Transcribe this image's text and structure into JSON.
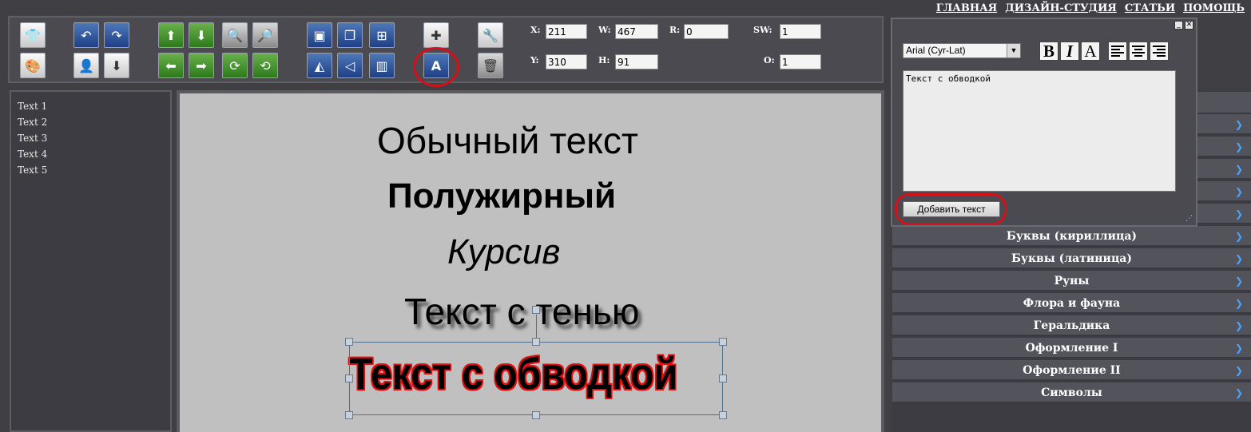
{
  "topnav": {
    "items": [
      "ГЛАВНАЯ",
      "ДИЗАЙН-СТУДИЯ",
      "СТАТЬИ",
      "ПОМОЩЬ"
    ]
  },
  "toolbar": {
    "icons": {
      "shirt": "shirt-icon",
      "palette": "palette-icon",
      "undo": "undo-icon",
      "redo": "redo-icon",
      "user_search": "user-search-icon",
      "download": "download-icon",
      "up": "arrow-up-icon",
      "down": "arrow-down-icon",
      "left": "arrow-left-icon",
      "right": "arrow-right-icon",
      "zoom_in": "zoom-in-icon",
      "zoom_out": "zoom-out-icon",
      "rotate_cw": "rotate-cw-icon",
      "rotate_ccw": "rotate-ccw-icon",
      "bring_front": "bring-front-icon",
      "send_back": "send-back-icon",
      "align": "align-icon",
      "flip_h": "flip-horizontal-icon",
      "flip_v": "flip-vertical-icon",
      "group": "group-icon",
      "add_image": "add-image-icon",
      "add_text": "add-text-icon",
      "tools": "tools-icon",
      "trash": "trash-icon"
    },
    "coords": {
      "x_label": "X:",
      "x_value": "211",
      "y_label": "Y:",
      "y_value": "310",
      "w_label": "W:",
      "w_value": "467",
      "h_label": "H:",
      "h_value": "91",
      "r_label": "R:",
      "r_value": "0",
      "sw_label": "SW:",
      "sw_value": "1",
      "o_label": "O:",
      "o_value": "1"
    }
  },
  "layers": [
    "Text 1",
    "Text 2",
    "Text 3",
    "Text 4",
    "Text 5"
  ],
  "canvas": {
    "texts": {
      "normal": "Обычный текст",
      "bold": "Полужирный",
      "italic": "Курсив",
      "shadow": "Текст с тенью",
      "outline": "Текст с обводкой"
    }
  },
  "dialog": {
    "font_value": "Arial (Cyr-Lat)",
    "format_buttons": [
      "B",
      "I",
      "A"
    ],
    "text_value": "Текст с обводкой",
    "add_button": "Добавить текст",
    "minimize": "_",
    "close": "✕"
  },
  "categories": [
    "Буквы (кириллица)",
    "Буквы (латиница)",
    "Руны",
    "Флора и фауна",
    "Геральдика",
    "Оформление I",
    "Оформление II",
    "Символы"
  ],
  "colors": {
    "accent_red": "#d4101b",
    "chevron_blue": "#4aa3ff"
  }
}
